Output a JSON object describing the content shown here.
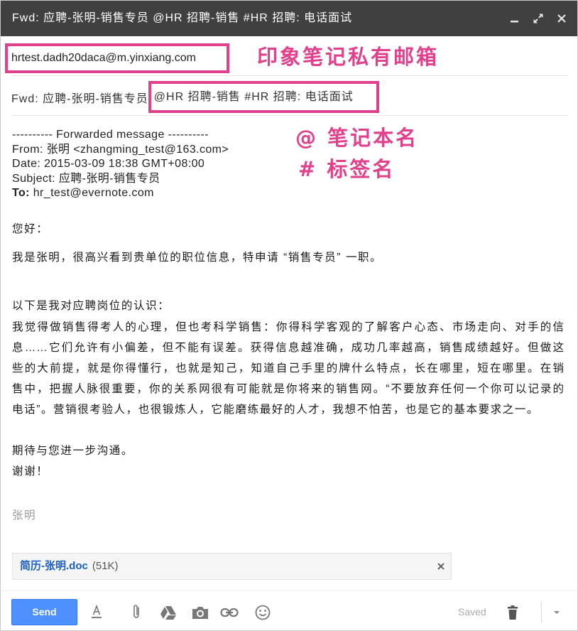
{
  "window": {
    "title": "Fwd: 应聘-张明-销售专员 @HR 招聘-销售 #HR 招聘: 电话面试"
  },
  "to": {
    "address": "hrtest.dadh20daca@m.yinxiang.com"
  },
  "subject": {
    "prefix": "Fwd: 应聘-张明-销售专员",
    "tags": "@HR 招聘-销售 #HR 招聘: 电话面试"
  },
  "annotations": {
    "private_email": "印象笔记私有邮箱",
    "notebook": "@ 笔记本名",
    "tag": "# 标签名"
  },
  "body": {
    "forward_header": {
      "divider": "---------- Forwarded message ----------",
      "from_label": "From:",
      "from": "张明 <zhangming_test@163.com>",
      "date_label": "Date:",
      "date": "2015-03-09 18:38 GMT+08:00",
      "subject_label": "Subject:",
      "subject": "应聘-张明-销售专员",
      "to_label": "To:",
      "to": "hr_test@evernote.com"
    },
    "greeting": "您好：",
    "intro": "我是张明，很高兴看到贵单位的职位信息，特申请 “销售专员” 一职。",
    "opinion_heading": "以下是我对应聘岗位的认识：",
    "opinion_lines": [
      "我觉得做销售得考人的心理，但也考科学销售：你得科学客观的了解客户心态、市场走向、对手的信",
      "息……它们允许有小偏差，但不能有误差。获得信息越准确，成功几率越高，销售成绩越好。但做这",
      "些的大前提，就是你得懂行，也就是知己，知道自己手里的牌什么特点，长在哪里，短在哪里。在销",
      "售中，把握人脉很重要，你的关系网很有可能就是你将来的销售网。“不要放弃任何一个你可以记录的",
      "电话”。营销很考验人，也很锻炼人，它能磨练最好的人才，我想不怕苦，也是它的基本要求之一。"
    ],
    "closing": "期待与您进一步沟通。",
    "thanks": "谢谢！",
    "signature": "张明"
  },
  "attachment": {
    "name": "简历-张明.doc",
    "size": "(51K)"
  },
  "toolbar": {
    "send_label": "Send",
    "status": "Saved"
  },
  "icons": {
    "title_bar": [
      "minimize-icon",
      "expand-icon",
      "close-icon"
    ],
    "attachment": "close-icon",
    "toolbar": [
      "text-format-icon",
      "paperclip-icon",
      "google-drive-icon",
      "camera-icon",
      "link-icon",
      "emoji-icon",
      "trash-icon",
      "chevron-down-icon"
    ]
  },
  "colors": {
    "title_bar": "#404040",
    "annotation": "#e2408c",
    "send_button": "#4d90fe",
    "attachment_link": "#1a5fc8",
    "signature": "#999999"
  }
}
